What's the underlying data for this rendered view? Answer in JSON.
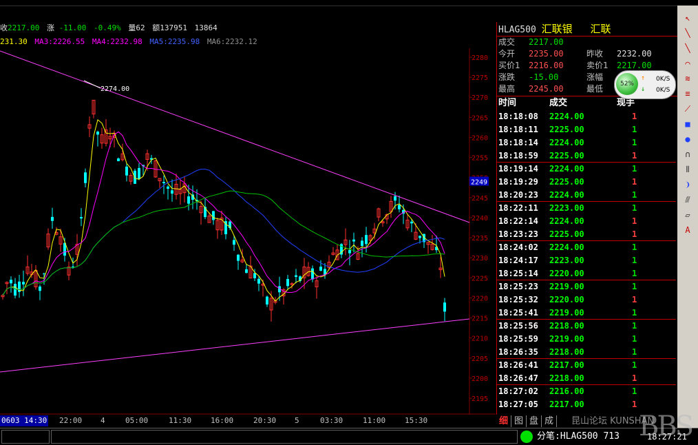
{
  "info_bar": {
    "close_label": "收",
    "close_value": "2217.00",
    "change_label": "涨",
    "change_value": "-11.00",
    "change_pct": "-0.49%",
    "volume_label": "量",
    "volume_value": "62",
    "amount_label": "额",
    "amount_value": "137951",
    "extra_value": "13864"
  },
  "ma_bar": {
    "ma1": "231.30",
    "ma3_label": "MA3:",
    "ma3": "2226.55",
    "ma4_label": "MA4:",
    "ma4": "2232.98",
    "ma5_label": "MA5:",
    "ma5": "2235.98",
    "ma6_label": "MA6:",
    "ma6": "2232.12"
  },
  "colors": {
    "up": "#ff3030",
    "down": "#00ffff",
    "ma3": "#ffff00",
    "ma4": "#ff00ff",
    "ma5": "#2040ff",
    "ma6": "#00c000",
    "trend": "#ff40ff",
    "grid": "#800000"
  },
  "chart_data": {
    "type": "candlestick",
    "yticks": [
      "2280",
      "2275",
      "2270",
      "2265",
      "2260",
      "2255",
      "2250",
      "2245",
      "2240",
      "2235",
      "2230",
      "2225",
      "2220",
      "2215",
      "2210",
      "2205",
      "2200",
      "2195"
    ],
    "ylim": [
      2192,
      2283
    ],
    "current_price_label": "2249",
    "high_annotation": "2274.00",
    "xticks": [
      "0603 14:30",
      "22:00",
      "4",
      "05:00",
      "11:30",
      "16:00",
      "20:30",
      "5",
      "03:30",
      "11:00",
      "15:30"
    ]
  },
  "quote_panel": {
    "symbol": "HLAG500",
    "name": "汇联银",
    "name2": "汇联",
    "rows": [
      {
        "label1": "成交",
        "value1": "2217.00",
        "label2": "",
        "value2": ""
      },
      {
        "label1": "今开",
        "value1": "2235.00",
        "label2": "昨收",
        "value2": "2232.00"
      },
      {
        "label1": "买价1",
        "value1": "2216.00",
        "label2": "卖价1",
        "value2": "2217.00"
      },
      {
        "label1": "涨跌",
        "value1": "-15.00",
        "label2": "涨幅",
        "value2": ""
      },
      {
        "label1": "最高",
        "value1": "2245.00",
        "label2": "最低",
        "value2": ""
      }
    ]
  },
  "net_widget": {
    "percent": "52%",
    "up_speed": "0K/S",
    "down_speed": "0K/S"
  },
  "trades": {
    "headers": [
      "时间",
      "成交",
      "现手"
    ],
    "rows": [
      {
        "time": "18:18:08",
        "price": "2224.00",
        "qty": "1"
      },
      {
        "time": "18:18:11",
        "price": "2225.00",
        "qty": "1"
      },
      {
        "time": "18:18:14",
        "price": "2224.00",
        "qty": "1"
      },
      {
        "time": "18:18:59",
        "price": "2225.00",
        "qty": "1"
      },
      {
        "time": "18:19:14",
        "price": "2224.00",
        "qty": "1"
      },
      {
        "time": "18:19:29",
        "price": "2225.00",
        "qty": "1"
      },
      {
        "time": "18:20:23",
        "price": "2224.00",
        "qty": "1"
      },
      {
        "time": "18:22:11",
        "price": "2223.00",
        "qty": "1"
      },
      {
        "time": "18:22:14",
        "price": "2224.00",
        "qty": "1"
      },
      {
        "time": "18:23:23",
        "price": "2225.00",
        "qty": "1"
      },
      {
        "time": "18:24:02",
        "price": "2224.00",
        "qty": "1"
      },
      {
        "time": "18:24:17",
        "price": "2223.00",
        "qty": "1"
      },
      {
        "time": "18:25:14",
        "price": "2220.00",
        "qty": "1"
      },
      {
        "time": "18:25:23",
        "price": "2219.00",
        "qty": "1"
      },
      {
        "time": "18:25:32",
        "price": "2220.00",
        "qty": "1"
      },
      {
        "time": "18:25:41",
        "price": "2219.00",
        "qty": "1"
      },
      {
        "time": "18:25:56",
        "price": "2218.00",
        "qty": "1"
      },
      {
        "time": "18:25:59",
        "price": "2219.00",
        "qty": "1"
      },
      {
        "time": "18:26:35",
        "price": "2218.00",
        "qty": "1"
      },
      {
        "time": "18:26:41",
        "price": "2217.00",
        "qty": "1"
      },
      {
        "time": "18:26:47",
        "price": "2218.00",
        "qty": "1"
      },
      {
        "time": "18:27:02",
        "price": "2216.00",
        "qty": "1"
      },
      {
        "time": "18:27:05",
        "price": "2217.00",
        "qty": "1"
      }
    ],
    "qty_colors": [
      "red",
      "green",
      "green",
      "red",
      "green",
      "red",
      "green",
      "green",
      "red",
      "red",
      "green",
      "green",
      "green",
      "green",
      "red",
      "green",
      "green",
      "green",
      "green",
      "green",
      "red",
      "green",
      "red"
    ]
  },
  "tabs": [
    "细",
    "图",
    "盘",
    "成"
  ],
  "status_bar": {
    "label": "分笔:",
    "symbol": "HLAG500",
    "value": "713",
    "clock": "18:27:21"
  },
  "watermark": {
    "text": "昆山论坛 KUNSHAN",
    "logo": "BBS"
  },
  "toolbar": {
    "tools": [
      "pointer-tool",
      "line-tool",
      "ray-tool",
      "arc-tool",
      "fan-tool",
      "channel-tool",
      "gann-tool",
      "rect-tool",
      "ellipse-tool",
      "cycle-tool",
      "parallel-tool",
      "arrow-tool",
      "fib-tool",
      "eraser-tool",
      "text-tool"
    ]
  }
}
